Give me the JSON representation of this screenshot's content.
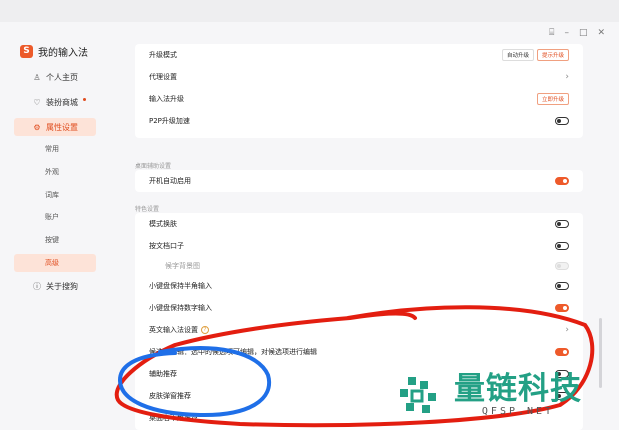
{
  "app": {
    "title": "我的输入法",
    "logo_glyph": "S"
  },
  "window_controls": {
    "pin": "⌸",
    "minimize": "–",
    "maximize": "□",
    "close": "✕"
  },
  "sidebar": {
    "items": [
      {
        "label": "个人主页",
        "icon": "person-icon",
        "glyph": "♙"
      },
      {
        "label": "装扮商城",
        "icon": "shirt-icon",
        "glyph": "♡",
        "badge_dot": true
      },
      {
        "label": "属性设置",
        "icon": "gear-icon",
        "glyph": "⚙",
        "active": true
      },
      {
        "label": "关于搜狗",
        "icon": "info-icon",
        "glyph": "ⓘ"
      }
    ],
    "subitems": [
      {
        "label": "常用"
      },
      {
        "label": "外观"
      },
      {
        "label": "词库"
      },
      {
        "label": "账户"
      },
      {
        "label": "按键"
      },
      {
        "label": "高级",
        "active": true
      }
    ]
  },
  "main": {
    "top_rows": [
      {
        "label": "升级模式",
        "buttons": [
          "自动升级",
          "提示升级"
        ]
      },
      {
        "label": "代理设置",
        "control": "chevron"
      },
      {
        "label": "输入法升级",
        "button": "立即升级"
      },
      {
        "label": "P2P升级加速",
        "control": "toggle",
        "on": false
      }
    ],
    "section_desktop": "桌面辅助设置",
    "desktop_rows": [
      {
        "label": "开机自动启用",
        "control": "toggle",
        "on": true
      }
    ],
    "section_special": "特色设置",
    "special_rows": [
      {
        "label": "模式换肤",
        "control": "toggle",
        "on": false
      },
      {
        "label": "按文档口子",
        "control": "toggle",
        "on": false
      },
      {
        "label": "候字背景图",
        "control": "toggle",
        "disabled": true,
        "indent": true
      },
      {
        "label": "小键盘保持半角输入",
        "control": "toggle",
        "on": false
      },
      {
        "label": "小键盘保持数字输入",
        "control": "toggle",
        "on": true
      },
      {
        "label": "英文输入法设置",
        "control": "chevron",
        "help": "?"
      },
      {
        "label": "候选项编辑：选中的候选项可编辑，对候选项进行编辑",
        "control": "toggle",
        "on": true
      },
      {
        "label": "辅助推荐",
        "control": "toggle",
        "on": false
      },
      {
        "label": "皮肤弹窗推荐",
        "control": "toggle",
        "on": false
      },
      {
        "label": "桌面右下角推荐",
        "control": "toggle",
        "on": false
      }
    ]
  },
  "watermark": {
    "cn": "量链科技",
    "en": "QFSP.NET"
  },
  "colors": {
    "accent": "#ee5a2a",
    "active_bg": "#fde3d8",
    "annotation_red": "#e31e10",
    "annotation_blue": "#1f6fe8",
    "watermark_green": "#23a085"
  }
}
